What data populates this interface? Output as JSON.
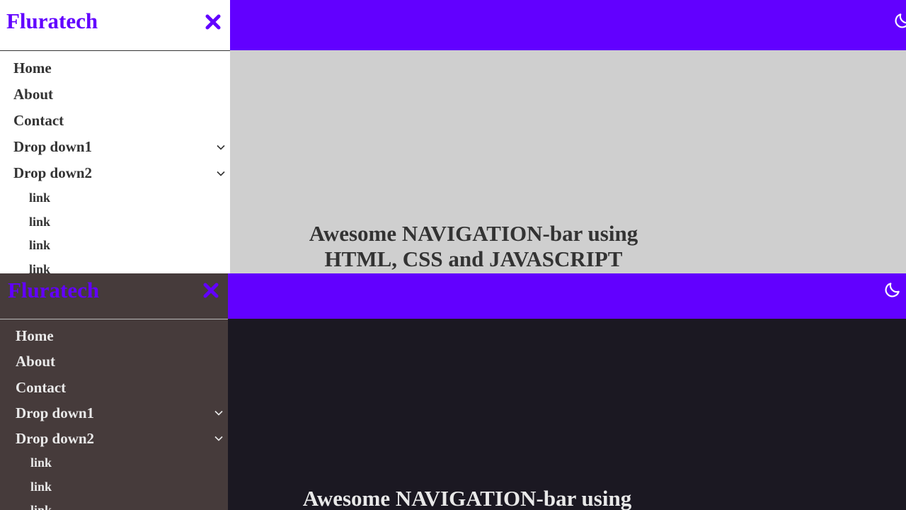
{
  "themes": [
    {
      "name": "light",
      "brand": "Fluratech",
      "menu": [
        {
          "label": "Home",
          "dropdown": false
        },
        {
          "label": "About",
          "dropdown": false
        },
        {
          "label": "Contact",
          "dropdown": false
        },
        {
          "label": "Drop down1",
          "dropdown": true
        },
        {
          "label": "Drop down2",
          "dropdown": true
        }
      ],
      "submenu": [
        "link",
        "link",
        "link",
        "link"
      ],
      "hero_line1": "Awesome NAVIGATION-bar using",
      "hero_line2": "HTML, CSS and JAVASCRIPT",
      "colors": {
        "accent": "#6200ff",
        "sidebar": "#ffffff",
        "content": "#cfcfcf",
        "text": "#333333"
      }
    },
    {
      "name": "dark",
      "brand": "Fluratech",
      "menu": [
        {
          "label": "Home",
          "dropdown": false
        },
        {
          "label": "About",
          "dropdown": false
        },
        {
          "label": "Contact",
          "dropdown": false
        },
        {
          "label": "Drop down1",
          "dropdown": true
        },
        {
          "label": "Drop down2",
          "dropdown": true
        }
      ],
      "submenu": [
        "link",
        "link",
        "link"
      ],
      "hero_line1": "Awesome NAVIGATION-bar using",
      "hero_line2": "",
      "colors": {
        "accent": "#6200ff",
        "sidebar": "#463b3b",
        "content": "#1b1822",
        "text": "#e9e9e9"
      }
    }
  ],
  "icons": {
    "close": "close-icon",
    "theme_toggle": "moon-icon",
    "dropdown": "chevron-down-icon"
  }
}
